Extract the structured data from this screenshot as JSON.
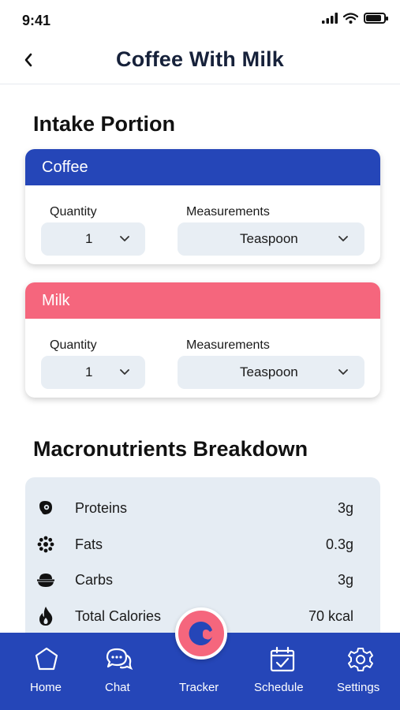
{
  "status_bar": {
    "time": "9:41"
  },
  "header": {
    "title": "Coffee With Milk"
  },
  "intake": {
    "title": "Intake Portion",
    "cards": [
      {
        "name": "Coffee",
        "color": "#2546b8",
        "quantity_label": "Quantity",
        "quantity_value": "1",
        "measurement_label": "Measurements",
        "measurement_value": "Teaspoon"
      },
      {
        "name": "Milk",
        "color": "#f5667d",
        "quantity_label": "Quantity",
        "quantity_value": "1",
        "measurement_label": "Measurements",
        "measurement_value": "Teaspoon"
      }
    ]
  },
  "macros": {
    "title": "Macronutrients Breakdown",
    "items": [
      {
        "name": "Proteins",
        "value": "3g",
        "icon": "protein-icon"
      },
      {
        "name": "Fats",
        "value": "0.3g",
        "icon": "fats-icon"
      },
      {
        "name": "Carbs",
        "value": "3g",
        "icon": "carbs-icon"
      },
      {
        "name": "Total Calories",
        "value": "70 kcal",
        "icon": "calories-icon"
      }
    ]
  },
  "nav": {
    "items": [
      {
        "label": "Home",
        "icon": "home-icon"
      },
      {
        "label": "Chat",
        "icon": "chat-icon"
      },
      {
        "label": "Tracker",
        "icon": "tracker-icon"
      },
      {
        "label": "Schedule",
        "icon": "schedule-icon"
      },
      {
        "label": "Settings",
        "icon": "settings-icon"
      }
    ]
  },
  "colors": {
    "primary": "#2546b8",
    "accent": "#f5667d",
    "panel": "#e5ecf3",
    "select": "#e8eef4"
  }
}
